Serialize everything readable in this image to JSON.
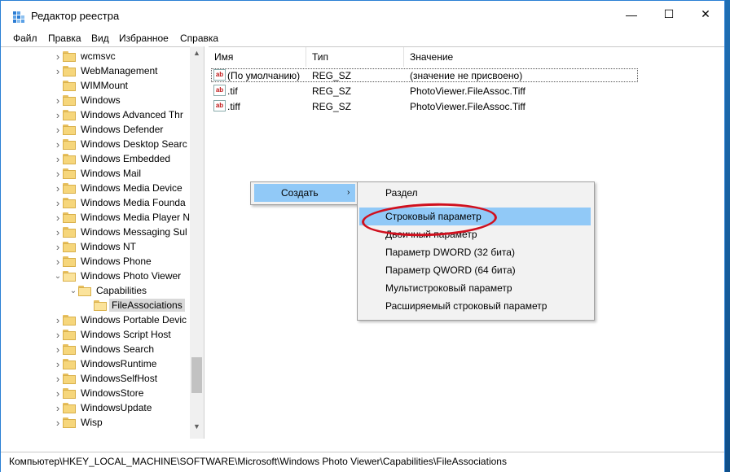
{
  "window": {
    "title": "Редактор реестра",
    "minimize": "—",
    "maximize": "☐",
    "close": "✕"
  },
  "menu": [
    "Файл",
    "Правка",
    "Вид",
    "Избранное",
    "Справка"
  ],
  "tree": {
    "items": [
      {
        "label": "wcmsvc",
        "expandable": true
      },
      {
        "label": "WebManagement",
        "expandable": true
      },
      {
        "label": "WIMMount",
        "expandable": false
      },
      {
        "label": "Windows",
        "expandable": true
      },
      {
        "label": "Windows Advanced Thr",
        "expandable": true
      },
      {
        "label": "Windows Defender",
        "expandable": true
      },
      {
        "label": "Windows Desktop Searc",
        "expandable": true
      },
      {
        "label": "Windows Embedded",
        "expandable": true
      },
      {
        "label": "Windows Mail",
        "expandable": true
      },
      {
        "label": "Windows Media Device",
        "expandable": true
      },
      {
        "label": "Windows Media Founda",
        "expandable": true
      },
      {
        "label": "Windows Media Player N",
        "expandable": true
      },
      {
        "label": "Windows Messaging Sul",
        "expandable": true
      },
      {
        "label": "Windows NT",
        "expandable": true
      },
      {
        "label": "Windows Phone",
        "expandable": true
      },
      {
        "label": "Windows Photo Viewer",
        "expandable": true,
        "expanded": true
      },
      {
        "label": "Capabilities",
        "expandable": true,
        "expanded": true,
        "level": 1
      },
      {
        "label": "FileAssociations",
        "expandable": false,
        "level": 2,
        "selected": true
      },
      {
        "label": "Windows Portable Devic",
        "expandable": true
      },
      {
        "label": "Windows Script Host",
        "expandable": true
      },
      {
        "label": "Windows Search",
        "expandable": true
      },
      {
        "label": "WindowsRuntime",
        "expandable": true
      },
      {
        "label": "WindowsSelfHost",
        "expandable": true
      },
      {
        "label": "WindowsStore",
        "expandable": true
      },
      {
        "label": "WindowsUpdate",
        "expandable": true
      },
      {
        "label": "Wisp",
        "expandable": true
      }
    ]
  },
  "list": {
    "columns": [
      "Имя",
      "Тип",
      "Значение"
    ],
    "rows": [
      {
        "name": "(По умолчанию)",
        "type": "REG_SZ",
        "value": "(значение не присвоено)"
      },
      {
        "name": ".tif",
        "type": "REG_SZ",
        "value": "PhotoViewer.FileAssoc.Tiff"
      },
      {
        "name": ".tiff",
        "type": "REG_SZ",
        "value": "PhotoViewer.FileAssoc.Tiff"
      }
    ]
  },
  "context_menu": {
    "create_label": "Создать",
    "submenu": [
      "Раздел",
      "Строковый параметр",
      "Двоичный параметр",
      "Параметр DWORD (32 бита)",
      "Параметр QWORD (64 бита)",
      "Мультистроковый параметр",
      "Расширяемый строковый параметр"
    ],
    "highlighted_index": 1
  },
  "statusbar": {
    "path": "Компьютер\\HKEY_LOCAL_MACHINE\\SOFTWARE\\Microsoft\\Windows Photo Viewer\\Capabilities\\FileAssociations"
  },
  "colors": {
    "highlight": "#91c9f7",
    "annotation": "#d0101e",
    "folder": "#f6d67b"
  }
}
